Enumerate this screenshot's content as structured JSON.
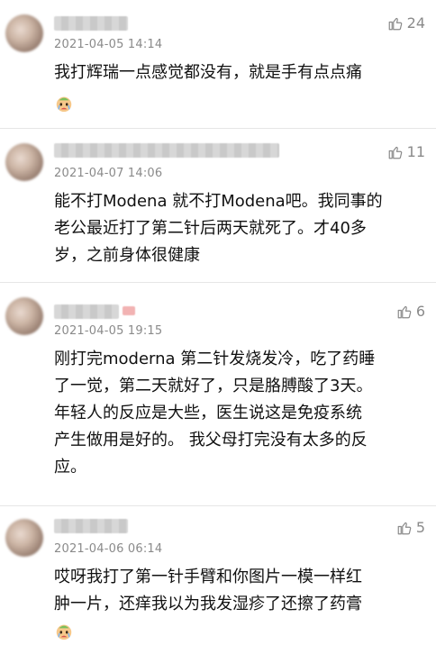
{
  "comments": [
    {
      "timestamp": "2021-04-05 14:14",
      "likes": "24",
      "text": "我打辉瑞一点感觉都没有，就是手有点点痛",
      "emoji": "crying-face-icon"
    },
    {
      "timestamp": "2021-04-07 14:06",
      "likes": "11",
      "text": "能不打Modena 就不打Modena吧。我同事的\n老公最近打了第二针后两天就死了。才40多\n岁，之前身体很健康"
    },
    {
      "timestamp": "2021-04-05 19:15",
      "likes": "6",
      "text": "刚打完moderna 第二针发烧发冷，吃了药睡\n了一觉，第二天就好了，只是胳膊酸了3天。\n年轻人的反应是大些，医生说这是免疫系统\n产生做用是好的。 我父母打完没有太多的反\n应。"
    },
    {
      "timestamp": "2021-04-06 06:14",
      "likes": "5",
      "text": "哎呀我打了第一针手臂和你图片一模一样红\n肿一片，还痒我以为我发湿疹了还擦了药膏",
      "emoji": "crying-face-icon"
    }
  ]
}
